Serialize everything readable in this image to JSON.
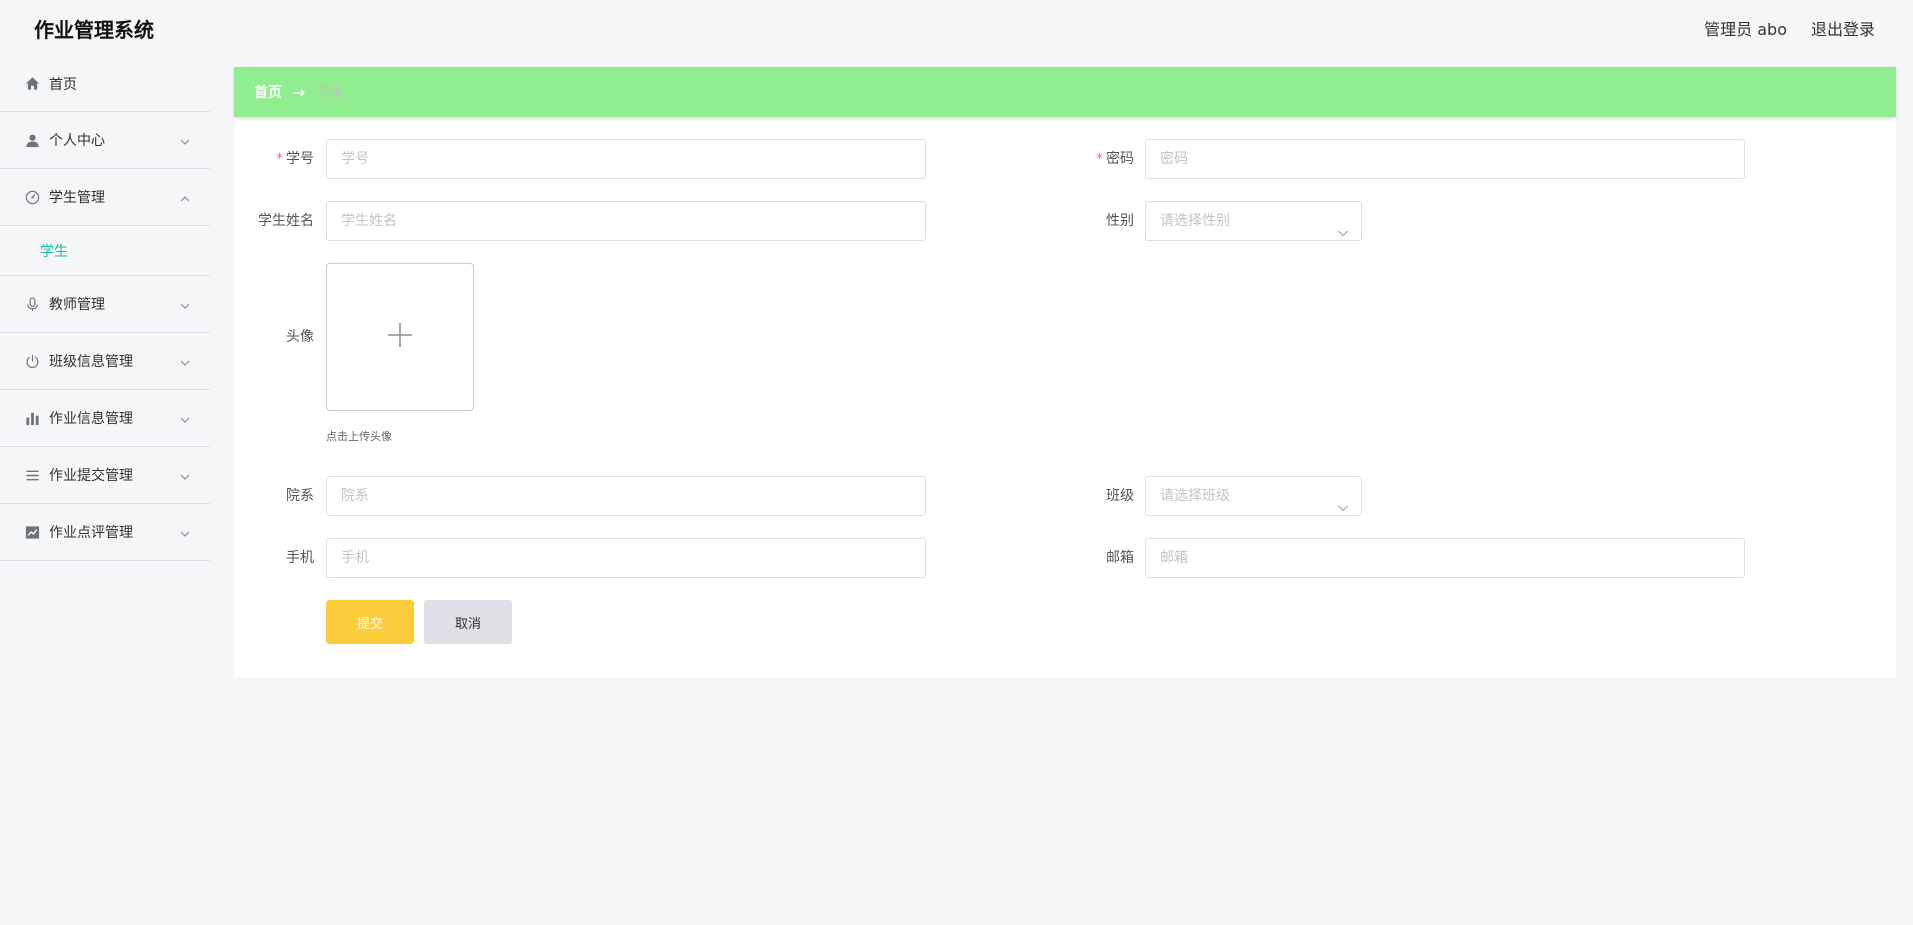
{
  "header": {
    "title": "作业管理系统",
    "user": "管理员 abo",
    "logout": "退出登录"
  },
  "sidebar": {
    "items": [
      {
        "label": "首页",
        "icon": "home-icon"
      },
      {
        "label": "个人中心",
        "icon": "user-icon"
      },
      {
        "label": "学生管理",
        "icon": "dashboard-icon",
        "expanded": true,
        "children": [
          {
            "label": "学生"
          }
        ]
      },
      {
        "label": "教师管理",
        "icon": "microphone-icon"
      },
      {
        "label": "班级信息管理",
        "icon": "power-icon"
      },
      {
        "label": "作业信息管理",
        "icon": "bar-chart-icon"
      },
      {
        "label": "作业提交管理",
        "icon": "list-icon"
      },
      {
        "label": "作业点评管理",
        "icon": "line-chart-icon"
      }
    ],
    "active_color": "#19be9b"
  },
  "breadcrumb": {
    "home": "首页",
    "separator": "→",
    "current": "学生",
    "bg_color": "#90ee90"
  },
  "form": {
    "student_id": {
      "label": "学号",
      "placeholder": "学号",
      "required": true
    },
    "password": {
      "label": "密码",
      "placeholder": "密码",
      "required": true
    },
    "student_name": {
      "label": "学生姓名",
      "placeholder": "学生姓名"
    },
    "gender": {
      "label": "性别",
      "placeholder": "请选择性别"
    },
    "avatar": {
      "label": "头像",
      "tip": "点击上传头像"
    },
    "department": {
      "label": "院系",
      "placeholder": "院系"
    },
    "class": {
      "label": "班级",
      "placeholder": "请选择班级"
    },
    "phone": {
      "label": "手机",
      "placeholder": "手机"
    },
    "email": {
      "label": "邮箱",
      "placeholder": "邮箱"
    },
    "submit": "提交",
    "cancel": "取消",
    "submit_color": "#fdcc3b"
  }
}
